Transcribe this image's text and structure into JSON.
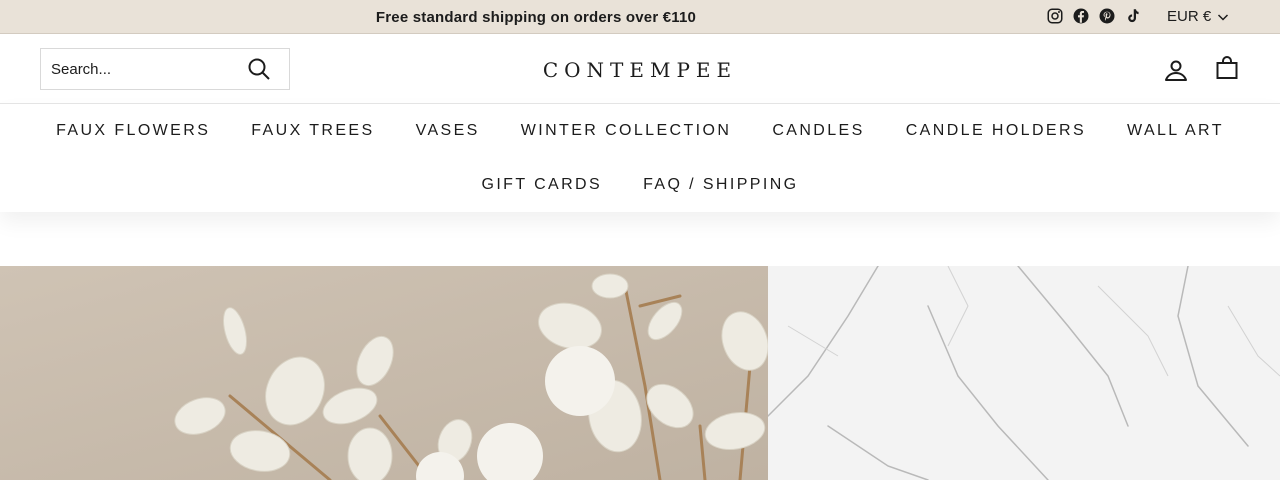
{
  "announcement": {
    "text": "Free standard shipping on orders over €110"
  },
  "social": [
    "instagram-icon",
    "facebook-icon",
    "pinterest-icon",
    "tiktok-icon"
  ],
  "currency": {
    "label": "EUR €"
  },
  "search": {
    "placeholder": "Search..."
  },
  "logo": {
    "text": "CONTEMPEE"
  },
  "nav": {
    "row1": [
      "FAUX FLOWERS",
      "FAUX TREES",
      "VASES",
      "WINTER COLLECTION",
      "CANDLES",
      "CANDLE HOLDERS",
      "WALL ART"
    ],
    "row2": [
      "GIFT CARDS",
      "FAQ / SHIPPING"
    ]
  },
  "colors": {
    "announcement_bg": "#e9e2d8",
    "text": "#1c1c1c",
    "hero_left_bg": "#cbbfb0",
    "hero_right_bg": "#f3f3f3"
  }
}
